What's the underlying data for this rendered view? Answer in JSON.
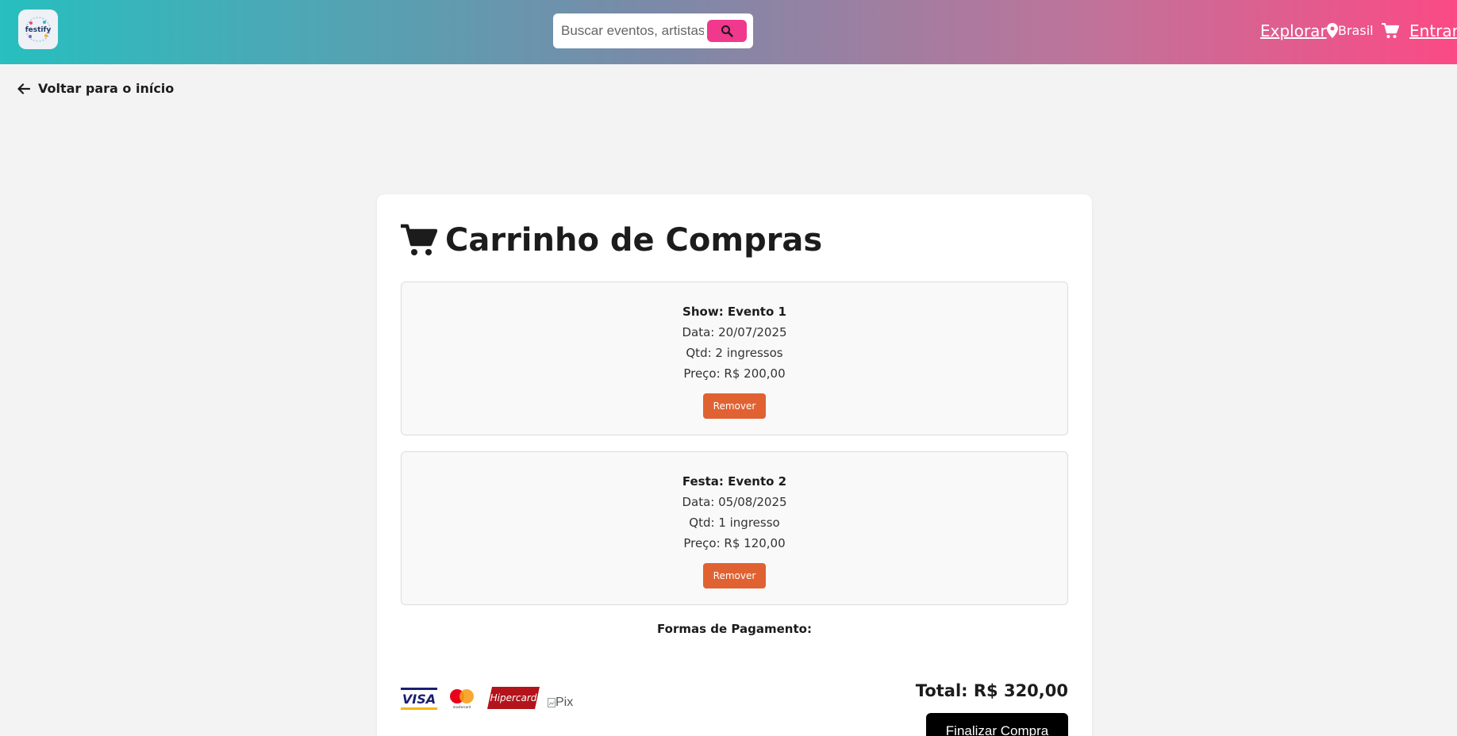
{
  "header": {
    "search_placeholder": "Buscar eventos, artistas, l",
    "nav_explore": "Explorar",
    "location": "Brasil",
    "nav_login": "Entrar"
  },
  "back_link": "Voltar para o início",
  "cart": {
    "title": "Carrinho de Compras",
    "items": [
      {
        "name": "Show: Evento 1",
        "date": "Data: 20/07/2025",
        "qty": "Qtd: 2 ingressos",
        "price": "Preço: R$ 200,00",
        "remove_label": "Remover"
      },
      {
        "name": "Festa: Evento 2",
        "date": "Data: 05/08/2025",
        "qty": "Qtd: 1 ingresso",
        "price": "Preço: R$ 120,00",
        "remove_label": "Remover"
      }
    ],
    "payment_title": "Formas de Pagamento:",
    "payment_methods": [
      "VISA",
      "mastercard",
      "Hipercard",
      "Pix"
    ],
    "total": "Total: R$ 320,00",
    "checkout_label": "Finalizar Compra"
  },
  "colors": {
    "brand_pink": "#f0388d",
    "brand_teal": "#27bfbf",
    "remove_orange": "#e06232"
  },
  "icons": [
    "festify-logo",
    "search-icon",
    "location-pin-icon",
    "cart-icon",
    "arrow-left-icon"
  ]
}
